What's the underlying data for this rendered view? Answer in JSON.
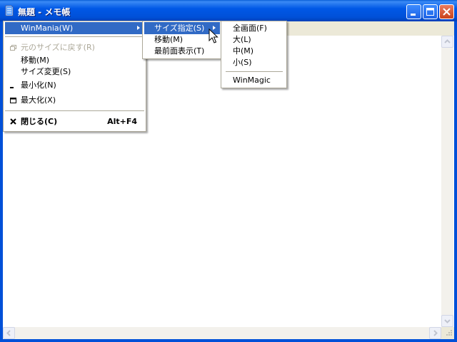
{
  "window": {
    "title": "無題 - メモ帳"
  },
  "system_menu": {
    "items": [
      {
        "label": "WinMania(W)",
        "submenu": true,
        "highlighted": true
      },
      {
        "label": "元のサイズに戻す(R)",
        "disabled": true,
        "icon": "restore-icon"
      },
      {
        "label": "移動(M)"
      },
      {
        "label": "サイズ変更(S)"
      },
      {
        "label": "最小化(N)",
        "icon": "minimize-icon"
      },
      {
        "label": "最大化(X)",
        "icon": "maximize-icon"
      },
      {
        "label": "閉じる(C)",
        "accelerator": "Alt+F4",
        "bold": true,
        "icon": "close-icon"
      }
    ]
  },
  "winmania_menu": {
    "items": [
      {
        "label": "サイズ指定(S)",
        "submenu": true,
        "highlighted": true
      },
      {
        "label": "移動(M)"
      },
      {
        "label": "最前面表示(T)"
      }
    ]
  },
  "size_menu": {
    "items": [
      {
        "label": "全画面(F)"
      },
      {
        "label": "大(L)"
      },
      {
        "label": "中(M)"
      },
      {
        "label": "小(S)"
      },
      {
        "label": "WinMagic"
      }
    ]
  },
  "colors": {
    "titlebar": "#0058e6",
    "menu_highlight": "#316ac5",
    "disabled_text": "#aca899"
  }
}
